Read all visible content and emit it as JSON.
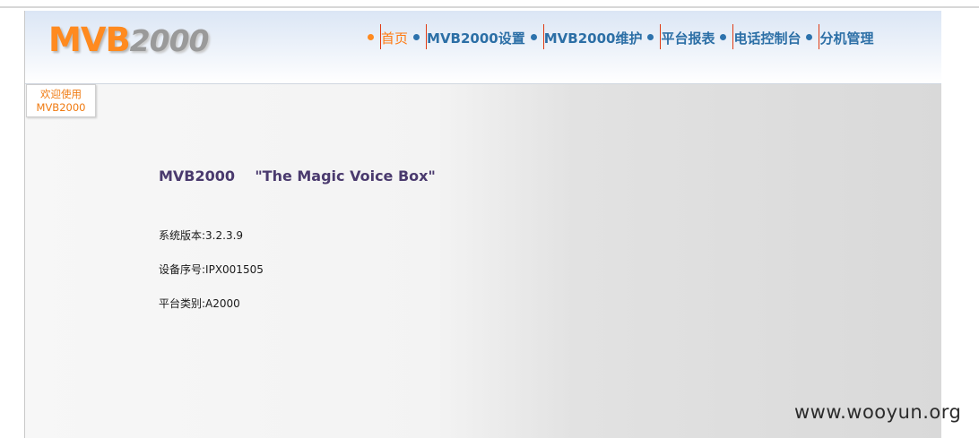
{
  "header": {
    "logo_main": "MVB",
    "logo_num": "2000"
  },
  "nav": {
    "items": [
      {
        "label": "首页",
        "active": true
      },
      {
        "label": "MVB2000设置",
        "active": false
      },
      {
        "label": "MVB2000维护",
        "active": false
      },
      {
        "label": "平台报表",
        "active": false
      },
      {
        "label": "电话控制台",
        "active": false
      },
      {
        "label": "分机管理",
        "active": false
      }
    ]
  },
  "sidebar": {
    "welcome_line1": "欢迎使用",
    "welcome_line2": "MVB2000"
  },
  "main": {
    "title": "MVB2000    \"The Magic Voice Box\"",
    "system_version": "系统版本:3.2.3.9",
    "device_serial": "设备序号:IPX001505",
    "platform_type": "平台类别:A2000"
  },
  "watermark": "www.wooyun.org",
  "colors": {
    "accent_orange": "#ff8a1f",
    "nav_blue": "#2c6fa6",
    "separator_red": "#e03b14",
    "title_purple": "#4a3a6e"
  }
}
